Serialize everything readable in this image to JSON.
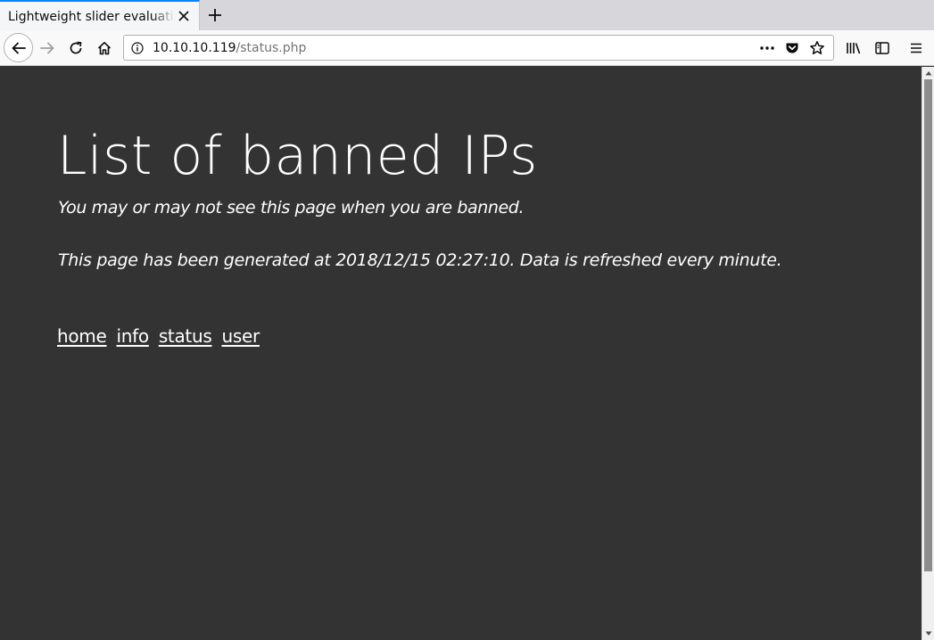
{
  "browser": {
    "tab": {
      "title": "Lightweight slider evaluation"
    },
    "url": {
      "host": "10.10.10.119",
      "path": "/status.php"
    }
  },
  "page": {
    "title": "List of banned IPs",
    "subtitle": "You may or may not see this page when you are banned.",
    "generated_note": "This page has been generated at 2018/12/15 02:27:10. Data is refreshed every minute.",
    "nav_links": [
      {
        "label": "home"
      },
      {
        "label": "info"
      },
      {
        "label": "status"
      },
      {
        "label": "user"
      }
    ]
  },
  "colors": {
    "page_background": "#333333",
    "text": "#ffffff",
    "tab_accent": "#0a84ff"
  },
  "icons": {
    "tab_close": "close-icon",
    "new_tab": "plus-icon",
    "back": "arrow-left-icon",
    "forward": "arrow-right-icon",
    "reload": "reload-icon",
    "home": "home-icon",
    "site_info": "info-icon",
    "page_actions": "ellipsis-icon",
    "pocket": "pocket-icon",
    "bookmark": "star-icon",
    "library": "library-icon",
    "sidebar": "sidebar-icon",
    "menu": "hamburger-menu-icon"
  }
}
